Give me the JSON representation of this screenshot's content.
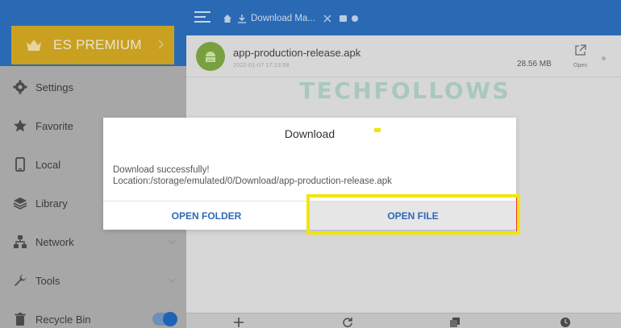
{
  "sidebar": {
    "premium_label": "ES PREMIUM",
    "items": [
      {
        "label": "Settings",
        "icon": "gear-icon"
      },
      {
        "label": "Favorite",
        "icon": "star-icon"
      },
      {
        "label": "Local",
        "icon": "phone-icon"
      },
      {
        "label": "Library",
        "icon": "layers-icon"
      },
      {
        "label": "Network",
        "icon": "network-icon"
      },
      {
        "label": "Tools",
        "icon": "wrench-icon"
      },
      {
        "label": "Recycle Bin",
        "icon": "trash-icon"
      }
    ],
    "recycle_toggle": "on"
  },
  "topbar": {
    "breadcrumb": "Download Ma..."
  },
  "file": {
    "name": "app-production-release.apk",
    "date": "2022-01-07 17:13:58",
    "size": "28.56 MB",
    "open_label": "Open",
    "icon_text": "APK"
  },
  "watermark": "TECHFOLLOWS",
  "dialog": {
    "title": "Download",
    "message_line1": "Download  successfully!",
    "message_line2": "Location:/storage/emulated/0/Download/app-production-release.apk",
    "btn_folder": "OPEN FOLDER",
    "btn_file": "OPEN FILE"
  },
  "colors": {
    "accent": "#2a6ab4",
    "premium": "#c9a01f",
    "highlight": "#f1e60a",
    "button_text": "#2d6ab5"
  }
}
